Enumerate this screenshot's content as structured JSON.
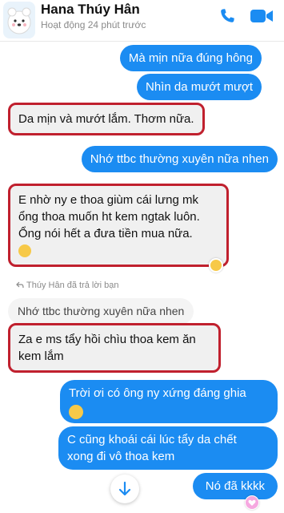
{
  "header": {
    "name": "Hana Thúy Hân",
    "status": "Hoạt động 24 phút trước"
  },
  "messages": {
    "m1": "Mà mịn nữa đúng hông",
    "m2": "Nhìn da mướt mượt",
    "m3": "Da mịn và mướt lắm. Thơm nữa.",
    "m4": "Nhớ ttbc thường xuyên nữa nhen",
    "m5_line1": "E nhờ ny e thoa giùm cái lưng mk",
    "m5_line2": "ổng thoa muốn ht kem ngtak luôn.",
    "m5_line3": "Ổng nói hết a đưa tiền mua nữa.",
    "reply_label": "Thúy Hân đã trả lời bạn",
    "quoted": "Nhớ ttbc thường xuyên nữa nhen",
    "m6_line1": "Za e ms tẩy hồi chìu thoa kem ăn",
    "m6_line2": "kem lắm",
    "m7_line1": "Trời ơi có ông ny xứng đáng ghia",
    "m8_line1": "C cũng khoái cái lúc tẩy da chết",
    "m8_line2": "xong đi vô thoa kem",
    "m9": "Nó đã kkkk"
  },
  "colors": {
    "outgoing": "#1b8cf2",
    "incoming": "#eeeeee",
    "highlight": "#c0202e",
    "header_icons": "#1b8cf2"
  },
  "icons": [
    "back-chevron-icon",
    "phone-icon",
    "video-camera-icon",
    "reply-arrow-icon",
    "laughing-emoji-icon",
    "smile-emoji-icon",
    "heart-icon",
    "arrow-down-icon"
  ]
}
